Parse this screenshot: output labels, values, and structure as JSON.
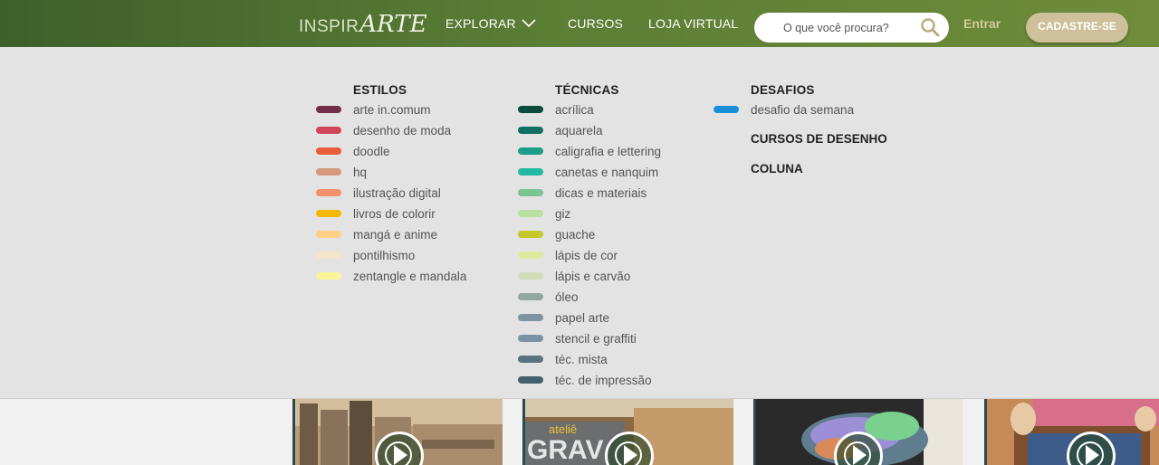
{
  "header": {
    "logo": {
      "part1": "INSPIR",
      "part2": "ARTE"
    },
    "nav": {
      "explorar": "EXPLORAR",
      "cursos": "CURSOS",
      "loja": "LOJA VIRTUAL"
    },
    "search": {
      "placeholder": "O que você procura?"
    },
    "entrar": "Entrar",
    "cadastre": "CADASTRE-SE"
  },
  "menu": {
    "estilos": {
      "title": "ESTILOS",
      "items": [
        {
          "label": "arte in.comum",
          "color": "#722f4a"
        },
        {
          "label": "desenho de moda",
          "color": "#d1455a"
        },
        {
          "label": "doodle",
          "color": "#ea5d3b"
        },
        {
          "label": "hq",
          "color": "#d6987c"
        },
        {
          "label": "ilustração digital",
          "color": "#f4906a"
        },
        {
          "label": "livros de colorir",
          "color": "#f5b800"
        },
        {
          "label": "mangá e anime",
          "color": "#fdd083"
        },
        {
          "label": "pontilhismo",
          "color": "#f4e5c8"
        },
        {
          "label": "zentangle e mandala",
          "color": "#fbf59a"
        }
      ]
    },
    "tecnicas": {
      "title": "TÉCNICAS",
      "items": [
        {
          "label": "acrílica",
          "color": "#0d4c3c"
        },
        {
          "label": "aquarela",
          "color": "#127062"
        },
        {
          "label": "caligrafia e lettering",
          "color": "#1a9e8a"
        },
        {
          "label": "canetas e nanquim",
          "color": "#23b8a4"
        },
        {
          "label": "dicas e materiais",
          "color": "#7cc392"
        },
        {
          "label": "giz",
          "color": "#b9e1a0"
        },
        {
          "label": "guache",
          "color": "#c4c82b"
        },
        {
          "label": "lápis de cor",
          "color": "#e0ea9e"
        },
        {
          "label": "lápis e carvão",
          "color": "#d1dcb9"
        },
        {
          "label": "óleo",
          "color": "#92a89e"
        },
        {
          "label": "papel arte",
          "color": "#7e94a0"
        },
        {
          "label": "stencil e graffiti",
          "color": "#7a93a4"
        },
        {
          "label": "téc. mista",
          "color": "#5b7381"
        },
        {
          "label": "téc. de impressão",
          "color": "#42606e"
        }
      ]
    },
    "desafios": {
      "title": "DESAFIOS",
      "items": [
        {
          "label": "desafio da semana",
          "color": "#1a8ed8"
        }
      ],
      "cursos_desenho": "CURSOS DE DESENHO",
      "coluna": "COLUNA"
    }
  },
  "thumbnails": {
    "atelie_label": "ateliê",
    "grav_label": "GRAV"
  }
}
